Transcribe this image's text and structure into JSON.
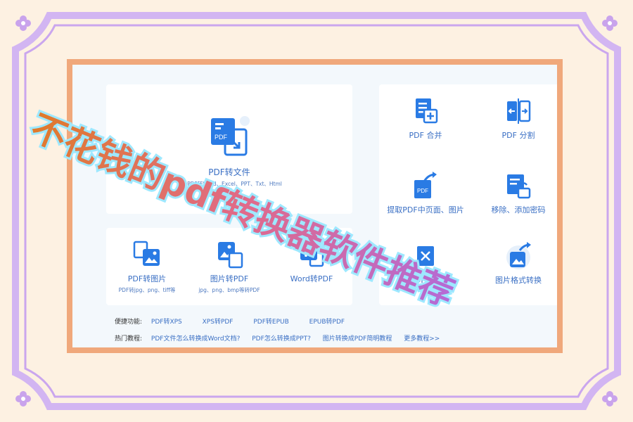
{
  "headline": {
    "text": "不花钱的pdf转换器软件推荐",
    "color_start": "#e07a2a",
    "color_end": "#b46ad6",
    "glow": "#8fe3ff"
  },
  "colors": {
    "frame": "#caa6ee",
    "frame_fill": "#fdf1e2",
    "card_border": "#f0a87b",
    "accent": "#2a7be4",
    "label": "#3a6fc4"
  },
  "main_tool": {
    "label": "PDF转文件",
    "sub": "支持PDF转Word、Excel、PPT、Txt、Html",
    "icon": "pdf-convert-icon"
  },
  "bottom_tools": [
    {
      "label": "PDF转图片",
      "sub": "PDF转jpg、png、tiff等",
      "icon": "pdf-to-image-icon"
    },
    {
      "label": "图片转PDF",
      "sub": "jpg、png、bmp等转PDF",
      "icon": "image-to-pdf-icon"
    },
    {
      "label": "Word转PDF",
      "sub": "",
      "icon": "word-to-pdf-icon"
    }
  ],
  "right_tools": [
    {
      "label": "PDF 合并",
      "icon": "pdf-merge-icon"
    },
    {
      "label": "PDF 分割",
      "icon": "pdf-split-icon"
    },
    {
      "label": "提取PDF中页面、图片",
      "icon": "pdf-extract-icon"
    },
    {
      "label": "移除、添加密码",
      "icon": "pdf-password-icon"
    },
    {
      "label": "PDF压缩",
      "icon": "pdf-compress-icon"
    },
    {
      "label": "图片格式转换",
      "icon": "image-format-icon"
    }
  ],
  "quick": {
    "title": "便捷功能:",
    "links": [
      "PDF转XPS",
      "XPS转PDF",
      "PDF转EPUB",
      "EPUB转PDF"
    ]
  },
  "tutorials": {
    "title": "热门教程:",
    "links": [
      "PDF文件怎么转换成Word文档?",
      "PDF怎么转换成PPT?",
      "图片转换成PDF简明教程",
      "更多教程>>"
    ]
  }
}
